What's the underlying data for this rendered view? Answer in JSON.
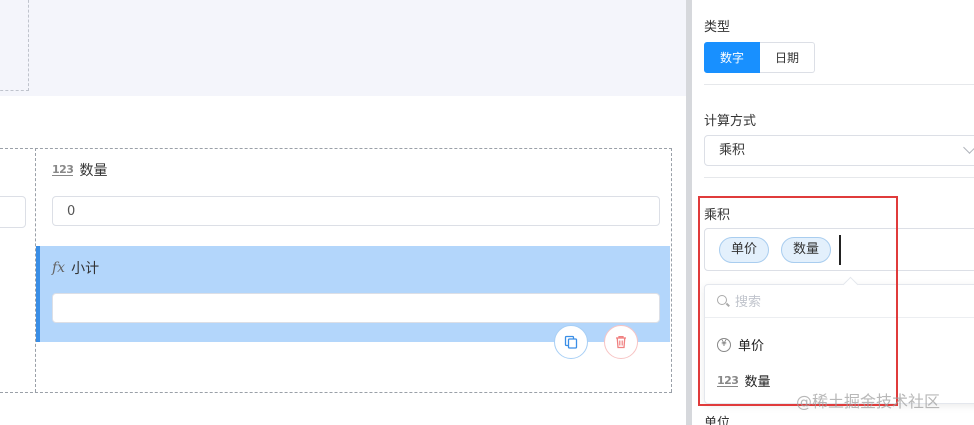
{
  "canvas": {
    "fields": [
      {
        "icon": "123",
        "label": "数量",
        "value": "0"
      },
      {
        "icon": "fx",
        "label": "小计",
        "value": ""
      }
    ]
  },
  "panel": {
    "type_section": {
      "label": "类型",
      "options": [
        "数字",
        "日期"
      ],
      "selected": "数字"
    },
    "calc_section": {
      "label": "计算方式",
      "selected": "乘积"
    },
    "formula_section": {
      "label": "乘积",
      "tags": [
        "单价",
        "数量"
      ],
      "search_placeholder": "搜索",
      "dropdown_items": [
        {
          "icon": "yen-icon",
          "label": "单价"
        },
        {
          "icon": "123",
          "label": "数量"
        }
      ]
    },
    "unit_section": {
      "label": "单位"
    }
  },
  "watermark": "@稀土掘金技术社区",
  "colors": {
    "accent": "#1890ff",
    "selected_bg": "#b3d6fb",
    "highlight_border": "#e03b3b"
  }
}
